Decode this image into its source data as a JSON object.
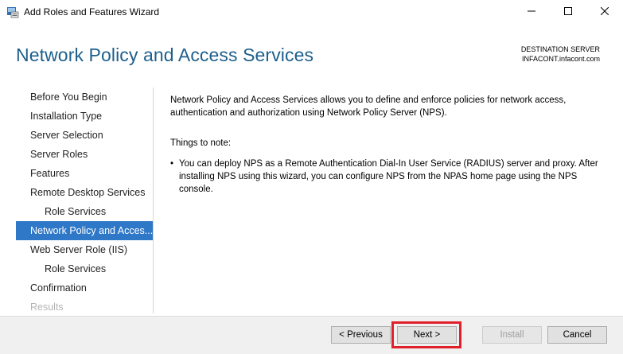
{
  "window": {
    "title": "Add Roles and Features Wizard"
  },
  "header": {
    "page_title": "Network Policy and Access Services",
    "destination_label": "DESTINATION SERVER",
    "destination_server": "INFACONT.infacont.com"
  },
  "nav": {
    "items": [
      {
        "label": "Before You Begin",
        "state": "normal"
      },
      {
        "label": "Installation Type",
        "state": "normal"
      },
      {
        "label": "Server Selection",
        "state": "normal"
      },
      {
        "label": "Server Roles",
        "state": "normal"
      },
      {
        "label": "Features",
        "state": "normal"
      },
      {
        "label": "Remote Desktop Services",
        "state": "normal"
      },
      {
        "label": "Role Services",
        "state": "sub"
      },
      {
        "label": "Network Policy and Acces...",
        "state": "active"
      },
      {
        "label": "Web Server Role (IIS)",
        "state": "normal"
      },
      {
        "label": "Role Services",
        "state": "sub"
      },
      {
        "label": "Confirmation",
        "state": "normal"
      },
      {
        "label": "Results",
        "state": "disabled"
      }
    ]
  },
  "content": {
    "intro": "Network Policy and Access Services allows you to define and enforce policies for network access, authentication and authorization using Network Policy Server (NPS).",
    "note_heading": "Things to note:",
    "bullet_char": "•",
    "bullet": "You can deploy NPS as a Remote Authentication Dial-In User Service (RADIUS) server and proxy. After installing NPS using this wizard,  you can configure NPS from the NPAS home page using the NPS console."
  },
  "footer": {
    "previous_label": "< Previous",
    "next_label": "Next >",
    "install_label": "Install",
    "cancel_label": "Cancel"
  },
  "colors": {
    "title_blue": "#1e5f8c",
    "nav_active": "#2f78c8",
    "highlight_red": "#e0202a"
  }
}
